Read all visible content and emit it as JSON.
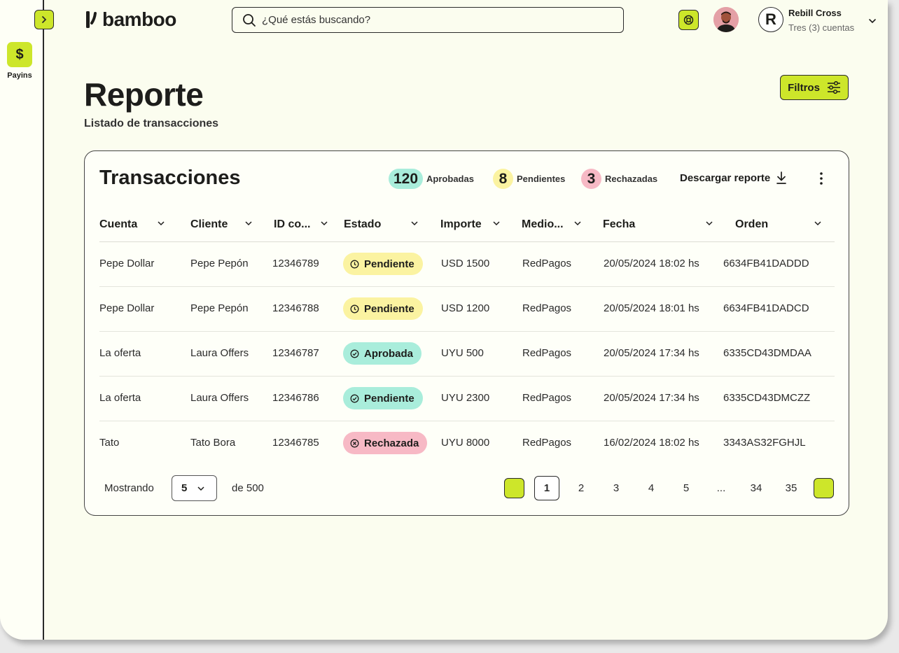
{
  "sidebar": {
    "items": [
      {
        "label": "Payins",
        "icon": "dollar-icon",
        "glyph": "$"
      }
    ]
  },
  "header": {
    "brand": "bamboo",
    "search_placeholder": "¿Qué estás buscando?",
    "user_initial": "R",
    "user_name": "Rebill Cross",
    "user_accounts": "Tres (3) cuentas"
  },
  "page": {
    "title": "Reporte",
    "subtitle": "Listado de transacciones",
    "filters_label": "Filtros"
  },
  "card": {
    "title": "Transacciones",
    "stats": [
      {
        "count": "120",
        "label": "Aprobadas",
        "color": "#a9eddb"
      },
      {
        "count": "8",
        "label": "Pendientes",
        "color": "#fbf3a1"
      },
      {
        "count": "3",
        "label": "Rechazadas",
        "color": "#f7b9c5"
      }
    ],
    "download_label": "Descargar reporte"
  },
  "table": {
    "columns": [
      "Cuenta",
      "Cliente",
      "ID co...",
      "Estado",
      "Importe",
      "Medio...",
      "Fecha",
      "Orden"
    ],
    "rows": [
      {
        "cuenta": "Pepe Dollar",
        "cliente": "Pepe Pepón",
        "id": "12346789",
        "estado": "Pendiente",
        "estado_type": "pend",
        "importe": "USD 1500",
        "medio": "RedPagos",
        "fecha": "20/05/2024 18:02 hs",
        "orden": "6634FB41DADDD"
      },
      {
        "cuenta": "Pepe Dollar",
        "cliente": "Pepe Pepón",
        "id": "12346788",
        "estado": "Pendiente",
        "estado_type": "pend",
        "importe": "USD 1200",
        "medio": "RedPagos",
        "fecha": "20/05/2024 18:01 hs",
        "orden": "6634FB41DADCD"
      },
      {
        "cuenta": "La oferta",
        "cliente": "Laura Offers",
        "id": "12346787",
        "estado": "Aprobada",
        "estado_type": "ok",
        "importe": "UYU 500",
        "medio": "RedPagos",
        "fecha": "20/05/2024 17:34 hs",
        "orden": "6335CD43DMDAA"
      },
      {
        "cuenta": "La oferta",
        "cliente": "Laura Offers",
        "id": "12346786",
        "estado": "Pendiente",
        "estado_type": "ok",
        "importe": "UYU 2300",
        "medio": "RedPagos",
        "fecha": "20/05/2024 17:34 hs",
        "orden": "6335CD43DMCZZ"
      },
      {
        "cuenta": "Tato",
        "cliente": "Tato Bora",
        "id": "12346785",
        "estado": "Rechazada",
        "estado_type": "rej",
        "importe": "UYU 8000",
        "medio": "RedPagos",
        "fecha": "16/02/2024 18:02 hs",
        "orden": "3343AS32FGHJL"
      }
    ]
  },
  "pagination": {
    "showing_label": "Mostrando",
    "page_size": "5",
    "total_label": "de 500",
    "pages": [
      "1",
      "2",
      "3",
      "4",
      "5",
      "...",
      "34",
      "35"
    ],
    "current_page": "1"
  },
  "colors": {
    "accent": "#cde62a",
    "background": "#fbfdef"
  }
}
